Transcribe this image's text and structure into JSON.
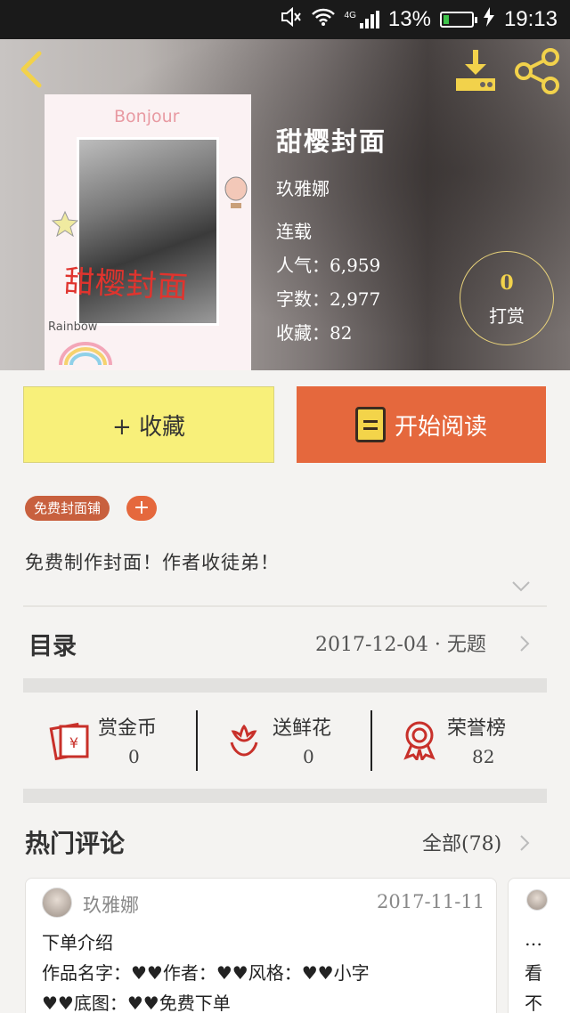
{
  "status_bar": {
    "battery": "13%",
    "time": "19:13",
    "network": "4G"
  },
  "book": {
    "title": "甜樱封面",
    "author": "玖雅娜",
    "status": "连载",
    "popularity": "人气：6,959",
    "word_count": "字数：2,977",
    "favorites": "收藏：82",
    "cover": {
      "top_text": "Bonjour",
      "handwritten_title": "甜樱封面",
      "corner_text": "Rainbow"
    }
  },
  "reward": {
    "count": "0",
    "label": "打赏"
  },
  "actions": {
    "collect_label": "+ 收藏",
    "read_label": "开始阅读"
  },
  "tags": {
    "first": "免费封面铺",
    "add": "+"
  },
  "description": "免费制作封面！作者收徒弟！",
  "toc": {
    "label": "目录",
    "latest": "2017-12-04 · 无题"
  },
  "stats": [
    {
      "label": "赏金币",
      "value": "0",
      "icon": "red-envelope-icon"
    },
    {
      "label": "送鲜花",
      "value": "0",
      "icon": "flower-icon"
    },
    {
      "label": "荣誉榜",
      "value": "82",
      "icon": "medal-icon"
    }
  ],
  "comments_section": {
    "title": "热门评论",
    "all_label": "全部(78)"
  },
  "comments": [
    {
      "author": "玖雅娜",
      "date": "2017-11-11",
      "lines": [
        "下单介绍",
        "作品名字：♥♥作者：♥♥风格：♥♥小字",
        "♥♥底图：♥♥免费下单"
      ]
    },
    {
      "lines": [
        "…",
        "看",
        "不"
      ]
    }
  ],
  "colors": {
    "accent": "#e5683d",
    "collect_bg": "#f8f07a",
    "gold": "#f2d24b"
  }
}
